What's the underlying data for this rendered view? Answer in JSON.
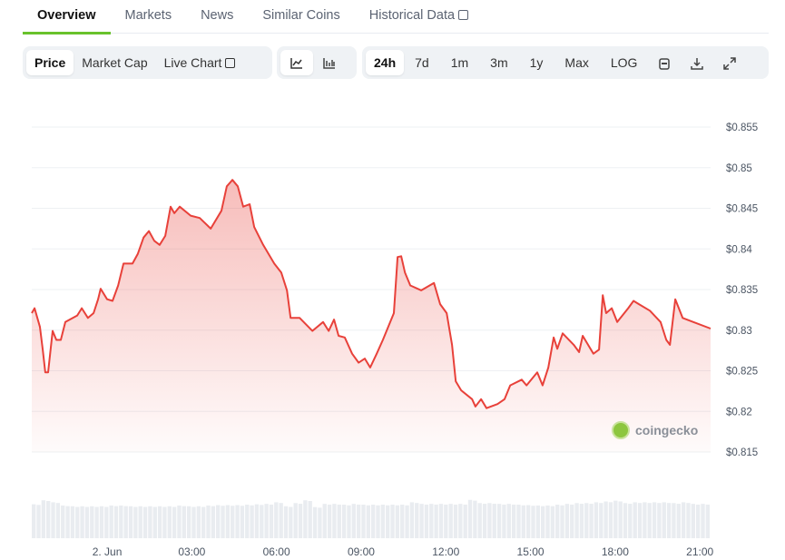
{
  "tabs": [
    "Overview",
    "Markets",
    "News",
    "Similar Coins",
    "Historical Data"
  ],
  "toolbar": {
    "data_types": [
      "Price",
      "Market Cap",
      "Live Chart"
    ],
    "chart_types": [
      "line-chart-icon",
      "candlestick-icon"
    ],
    "ranges": [
      "24h",
      "7d",
      "1m",
      "3m",
      "1y",
      "Max",
      "LOG"
    ],
    "selected_data": "Price",
    "selected_range": "24h",
    "tools": [
      "calendar-icon",
      "download-icon",
      "fullscreen-icon"
    ]
  },
  "watermark": "coingecko",
  "colors": {
    "line": "#e8413a",
    "accent": "#68c22c"
  },
  "chart_data": {
    "type": "line",
    "title": "",
    "xlabel": "",
    "ylabel": "",
    "x_unit": "hours since 2 Jun 00:00",
    "xlim": [
      -2.67,
      21.38
    ],
    "ylim": [
      0.815,
      0.855
    ],
    "y_ticks": [
      "$0.815",
      "$0.82",
      "$0.825",
      "$0.83",
      "$0.835",
      "$0.84",
      "$0.845",
      "$0.85",
      "$0.855"
    ],
    "y_tick_values": [
      0.815,
      0.82,
      0.825,
      0.83,
      0.835,
      0.84,
      0.845,
      0.85,
      0.855
    ],
    "x_ticks": [
      "2. Jun",
      "03:00",
      "06:00",
      "09:00",
      "12:00",
      "15:00",
      "18:00",
      "21:00"
    ],
    "x_tick_values": [
      0,
      3,
      6,
      9,
      12,
      15,
      18,
      21
    ],
    "grid": true,
    "series": [
      {
        "name": "Price",
        "points": [
          [
            -2.67,
            0.8321
          ],
          [
            -2.57,
            0.8327
          ],
          [
            -2.38,
            0.8304
          ],
          [
            -2.28,
            0.8276
          ],
          [
            -2.19,
            0.8248
          ],
          [
            -2.09,
            0.8248
          ],
          [
            -1.93,
            0.8299
          ],
          [
            -1.8,
            0.8288
          ],
          [
            -1.64,
            0.8288
          ],
          [
            -1.48,
            0.831
          ],
          [
            -1.06,
            0.8318
          ],
          [
            -0.9,
            0.8327
          ],
          [
            -0.68,
            0.8315
          ],
          [
            -0.48,
            0.8321
          ],
          [
            -0.32,
            0.8338
          ],
          [
            -0.23,
            0.8351
          ],
          [
            0,
            0.8338
          ],
          [
            0.19,
            0.8336
          ],
          [
            0.39,
            0.8355
          ],
          [
            0.58,
            0.8382
          ],
          [
            0.9,
            0.8382
          ],
          [
            1.09,
            0.8394
          ],
          [
            1.29,
            0.8414
          ],
          [
            1.48,
            0.8422
          ],
          [
            1.67,
            0.841
          ],
          [
            1.86,
            0.8405
          ],
          [
            2.06,
            0.8416
          ],
          [
            2.25,
            0.8452
          ],
          [
            2.38,
            0.8444
          ],
          [
            2.57,
            0.8452
          ],
          [
            2.96,
            0.8441
          ],
          [
            3.28,
            0.8438
          ],
          [
            3.67,
            0.8425
          ],
          [
            4.05,
            0.8447
          ],
          [
            4.24,
            0.8477
          ],
          [
            4.44,
            0.8485
          ],
          [
            4.63,
            0.8477
          ],
          [
            4.82,
            0.8452
          ],
          [
            5.05,
            0.8455
          ],
          [
            5.21,
            0.8427
          ],
          [
            5.53,
            0.8405
          ],
          [
            5.92,
            0.8382
          ],
          [
            6.17,
            0.8371
          ],
          [
            6.37,
            0.8349
          ],
          [
            6.5,
            0.8315
          ],
          [
            6.82,
            0.8315
          ],
          [
            7.27,
            0.8299
          ],
          [
            7.65,
            0.831
          ],
          [
            7.85,
            0.8299
          ],
          [
            8.04,
            0.8313
          ],
          [
            8.2,
            0.8293
          ],
          [
            8.42,
            0.8291
          ],
          [
            8.68,
            0.8271
          ],
          [
            8.91,
            0.826
          ],
          [
            9.13,
            0.8265
          ],
          [
            9.32,
            0.8254
          ],
          [
            9.55,
            0.8271
          ],
          [
            9.77,
            0.8288
          ],
          [
            10.16,
            0.8321
          ],
          [
            10.29,
            0.839
          ],
          [
            10.42,
            0.8391
          ],
          [
            10.55,
            0.8371
          ],
          [
            10.74,
            0.8355
          ],
          [
            11.13,
            0.8349
          ],
          [
            11.58,
            0.8358
          ],
          [
            11.8,
            0.8332
          ],
          [
            12.03,
            0.8321
          ],
          [
            12.22,
            0.8282
          ],
          [
            12.35,
            0.8237
          ],
          [
            12.54,
            0.8226
          ],
          [
            12.93,
            0.8215
          ],
          [
            13.05,
            0.8206
          ],
          [
            13.25,
            0.8215
          ],
          [
            13.44,
            0.8204
          ],
          [
            13.83,
            0.8209
          ],
          [
            14.08,
            0.8215
          ],
          [
            14.28,
            0.8232
          ],
          [
            14.69,
            0.8239
          ],
          [
            14.86,
            0.8232
          ],
          [
            15.24,
            0.8248
          ],
          [
            15.43,
            0.8232
          ],
          [
            15.63,
            0.8254
          ],
          [
            15.82,
            0.8291
          ],
          [
            15.95,
            0.8277
          ],
          [
            16.14,
            0.8296
          ],
          [
            16.53,
            0.8282
          ],
          [
            16.72,
            0.8273
          ],
          [
            16.85,
            0.8293
          ],
          [
            17.04,
            0.8282
          ],
          [
            17.23,
            0.8271
          ],
          [
            17.43,
            0.8276
          ],
          [
            17.56,
            0.8343
          ],
          [
            17.68,
            0.8321
          ],
          [
            17.88,
            0.8327
          ],
          [
            18.07,
            0.831
          ],
          [
            18.46,
            0.8327
          ],
          [
            18.65,
            0.8336
          ],
          [
            18.84,
            0.8332
          ],
          [
            19.23,
            0.8324
          ],
          [
            19.61,
            0.831
          ],
          [
            19.81,
            0.8288
          ],
          [
            19.94,
            0.8282
          ],
          [
            20.13,
            0.8338
          ],
          [
            20.39,
            0.8315
          ],
          [
            20.77,
            0.831
          ],
          [
            21.38,
            0.8302
          ]
        ]
      }
    ],
    "volume_relative": [
      0.85,
      0.95,
      0.9,
      0.82,
      0.8,
      0.8,
      0.8,
      0.8,
      0.82,
      0.82,
      0.8,
      0.8,
      0.8,
      0.8,
      0.8,
      0.82,
      0.8,
      0.8,
      0.82,
      0.83,
      0.83,
      0.83,
      0.84,
      0.85,
      0.86,
      0.9,
      0.8,
      0.88,
      0.95,
      0.78,
      0.86,
      0.86,
      0.84,
      0.86,
      0.84,
      0.84,
      0.84,
      0.84,
      0.84,
      0.9,
      0.86,
      0.86,
      0.86,
      0.86,
      0.86,
      0.96,
      0.88,
      0.88,
      0.86,
      0.86,
      0.84,
      0.83,
      0.82,
      0.82,
      0.84,
      0.86,
      0.88,
      0.88,
      0.9,
      0.92,
      0.94,
      0.88,
      0.9,
      0.9,
      0.9,
      0.9,
      0.88,
      0.9,
      0.86,
      0.86
    ]
  }
}
